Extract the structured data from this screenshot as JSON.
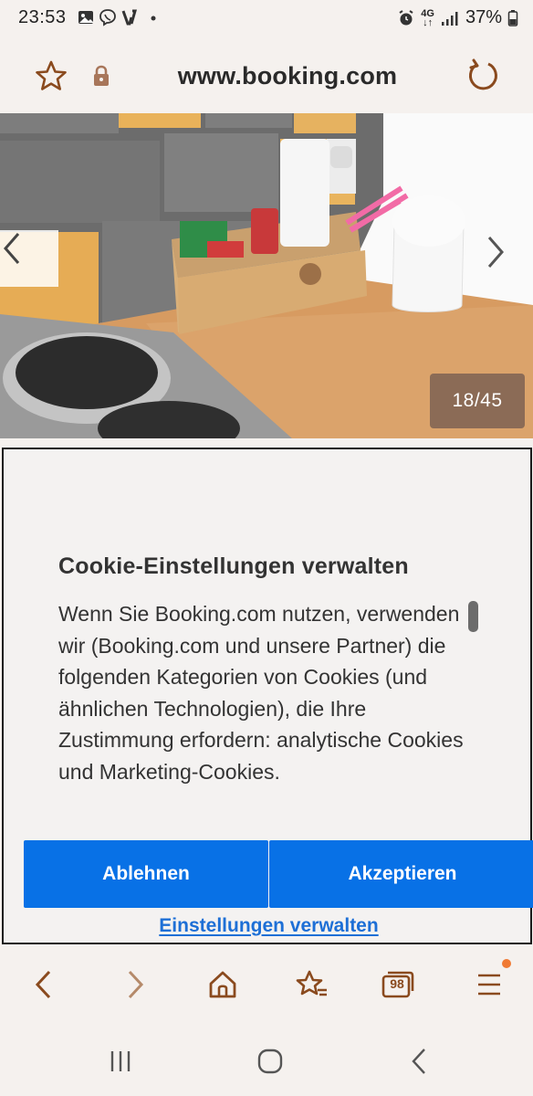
{
  "status_bar": {
    "time": "23:53",
    "left_icons": [
      "gallery-icon",
      "viber-icon",
      "v-app-icon",
      "dot-icon"
    ],
    "network": "4G",
    "battery": "37%"
  },
  "browser": {
    "url": "www.booking.com"
  },
  "gallery": {
    "counter": "18/45"
  },
  "cookie_dialog": {
    "title": "Cookie-Einstellungen verwalten",
    "body": "Wenn Sie Booking.com nutzen, verwenden wir (Booking.com und unsere Partner) die folgenden Kategorien von Cookies (und ähnlichen Technologien), die Ihre Zustimmung erfordern: analytische Cookies und Marketing-Cookies.",
    "reject_label": "Ablehnen",
    "accept_label": "Akzeptieren",
    "settings_label": "Einstellungen verwalten"
  },
  "bottom_nav": {
    "tabs_count": "98"
  },
  "colors": {
    "accent": "#0871e6",
    "browser_icons": "#8a4a1e",
    "badge": "#f07a34"
  }
}
